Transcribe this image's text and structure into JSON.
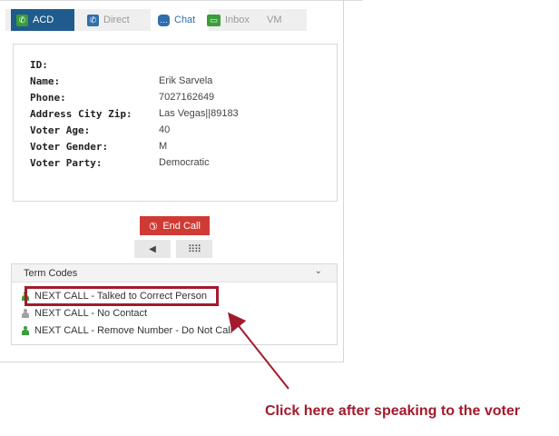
{
  "tabs": [
    {
      "label": "ACD",
      "icon": "phone-icon"
    },
    {
      "label": "Direct",
      "icon": "phone-icon"
    },
    {
      "label": "Chat",
      "icon": "chat-icon"
    },
    {
      "label": "Inbox",
      "icon": "inbox-icon"
    },
    {
      "label": "VM",
      "icon": ""
    }
  ],
  "contact": {
    "rows": [
      {
        "label": "ID:",
        "value": ""
      },
      {
        "label": "Name:",
        "value": "Erik Sarvela"
      },
      {
        "label": "Phone:",
        "value": "7027162649"
      },
      {
        "label": "Address City Zip:",
        "value": "Las Vegas||89183"
      },
      {
        "label": "Voter Age:",
        "value": "40"
      },
      {
        "label": "Voter Gender:",
        "value": "M"
      },
      {
        "label": "Voter Party:",
        "value": "Democratic"
      }
    ]
  },
  "controls": {
    "end_call_label": "End Call",
    "mute_icon": "speaker-icon",
    "keypad_icon": "keypad-icon"
  },
  "term_codes": {
    "title": "Term Codes",
    "items": [
      {
        "label": "NEXT CALL - Talked to Correct Person",
        "status": "green"
      },
      {
        "label": "NEXT CALL - No Contact",
        "status": "gray"
      },
      {
        "label": "NEXT CALL - Remove Number - Do Not Call",
        "status": "green"
      }
    ]
  },
  "annotation": {
    "callout_text": "Click here after speaking to the voter",
    "color": "#a31a2c"
  },
  "colors": {
    "tab_active": "#1f5b8c",
    "end_call": "#cf3b34",
    "green": "#3a9d3a"
  }
}
